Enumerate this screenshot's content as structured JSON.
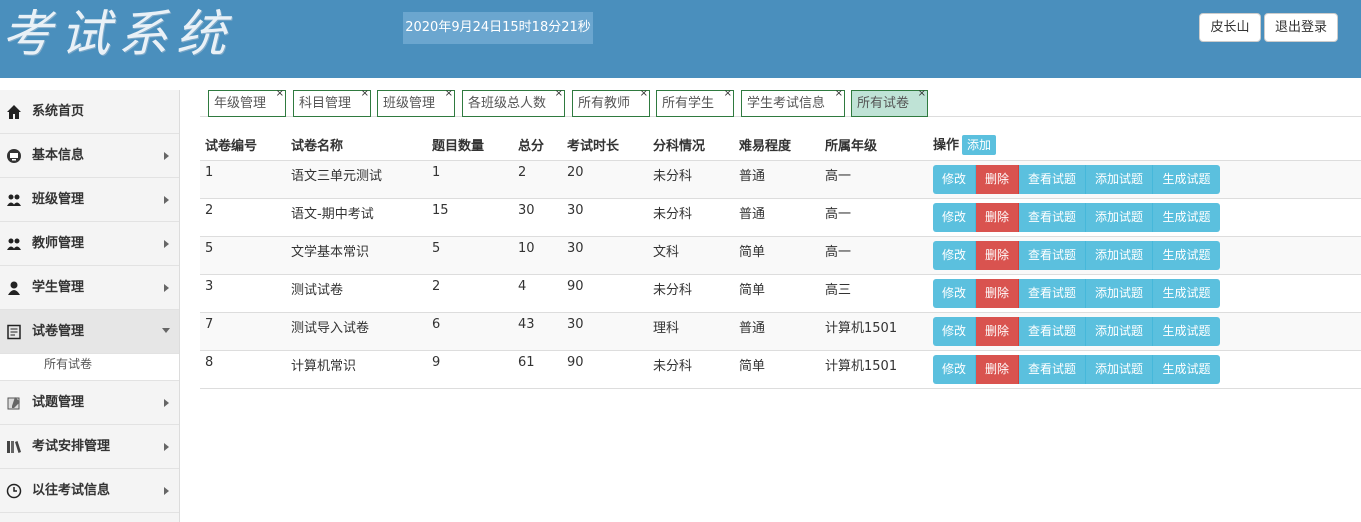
{
  "header": {
    "logo": "考试系统",
    "datetime": "2020年9月24日15时18分21秒",
    "user_button": "皮长山",
    "logout_button": "退出登录"
  },
  "sidebar": {
    "items": [
      {
        "label": "系统首页",
        "icon": "home-icon"
      },
      {
        "label": "基本信息",
        "icon": "monitor-icon"
      },
      {
        "label": "班级管理",
        "icon": "group-icon"
      },
      {
        "label": "教师管理",
        "icon": "teacher-icon"
      },
      {
        "label": "学生管理",
        "icon": "student-icon"
      },
      {
        "label": "试卷管理",
        "icon": "paper-icon"
      },
      {
        "label": "试题管理",
        "icon": "question-icon"
      },
      {
        "label": "考试安排管理",
        "icon": "books-icon"
      },
      {
        "label": "以往考试信息",
        "icon": "clock-icon"
      }
    ],
    "sub_item": "所有试卷"
  },
  "tabs": [
    {
      "label": "年级管理"
    },
    {
      "label": "科目管理"
    },
    {
      "label": "班级管理"
    },
    {
      "label": "各班级总人数"
    },
    {
      "label": "所有教师"
    },
    {
      "label": "所有学生"
    },
    {
      "label": "学生考试信息"
    },
    {
      "label": "所有试卷"
    }
  ],
  "tab_close": "×",
  "table": {
    "headers": [
      "试卷编号",
      "试卷名称",
      "题目数量",
      "总分",
      "考试时长",
      "分科情况",
      "难易程度",
      "所属年级",
      "操作"
    ],
    "add_button": "添加",
    "action_buttons": [
      "修改",
      "删除",
      "查看试题",
      "添加试题",
      "生成试题"
    ],
    "rows": [
      [
        "1",
        "语文三单元测试",
        "1",
        "2",
        "20",
        "未分科",
        "普通",
        "高一"
      ],
      [
        "2",
        "语文-期中考试",
        "15",
        "30",
        "30",
        "未分科",
        "普通",
        "高一"
      ],
      [
        "5",
        "文学基本常识",
        "5",
        "10",
        "30",
        "文科",
        "简单",
        "高一"
      ],
      [
        "3",
        "测试试卷",
        "2",
        "4",
        "90",
        "未分科",
        "简单",
        "高三"
      ],
      [
        "7",
        "测试导入试卷",
        "6",
        "43",
        "30",
        "理科",
        "普通",
        "计算机1501"
      ],
      [
        "8",
        "计算机常识",
        "9",
        "61",
        "90",
        "未分科",
        "简单",
        "计算机1501"
      ]
    ]
  },
  "colors": {
    "header_bg": "#4a8fbd",
    "info": "#5bc0de",
    "danger": "#d9534f",
    "tab_border": "#2f7a3f",
    "tab_active_bg": "#bfe3d6"
  }
}
